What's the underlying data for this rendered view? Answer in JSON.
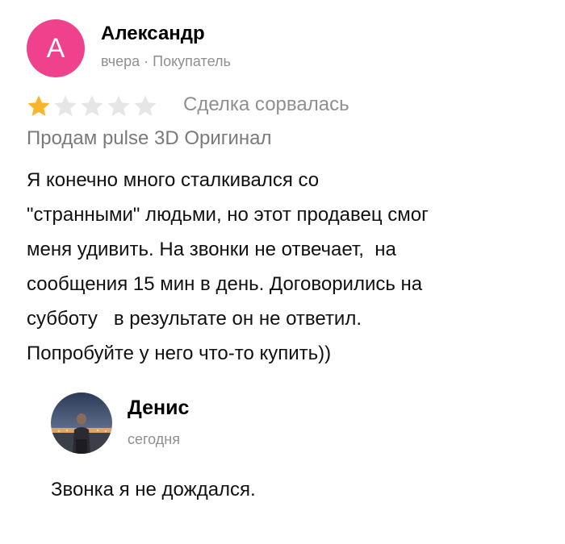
{
  "review": {
    "author_initial": "А",
    "author_name": "Александр",
    "meta": "вчера · Покупатель",
    "rating": 1,
    "rating_max": 5,
    "deal_status": "Сделка сорвалась",
    "product": "Продам pulse 3D Оригинал",
    "text_lines": [
      "Я конечно много сталкивался со",
      "\"странными\" людьми, но этот продавец смог",
      "меня удивить. На звонки не отвечает,  на",
      "сообщения 15 мин в день. Договорились на",
      "субботу   в результате он не ответил.",
      "Попробуйте у него что-то купить))"
    ]
  },
  "reply": {
    "author_name": "Денис",
    "date": "сегодня",
    "text": "Звонка я не дождался."
  },
  "colors": {
    "avatar_bg": "#f0418c",
    "star_filled": "#f7b52c",
    "star_empty": "#e6e6e6",
    "meta_text": "#8f8f8f"
  },
  "icons": {
    "star": "star-icon",
    "reply_avatar": "user-photo"
  }
}
